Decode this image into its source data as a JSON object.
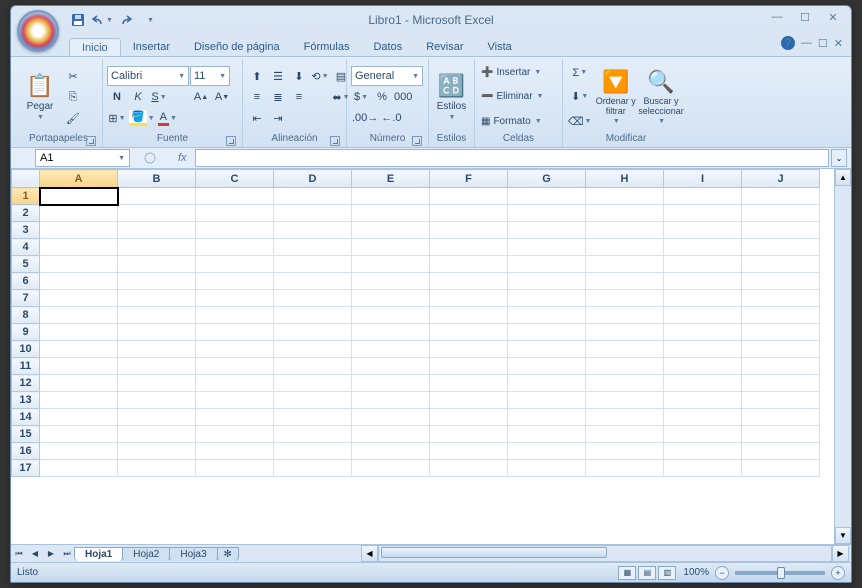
{
  "title": "Libro1 - Microsoft Excel",
  "qat": {
    "save": "💾",
    "undo": "↶",
    "redo": "↷"
  },
  "tabs": {
    "items": [
      "Inicio",
      "Insertar",
      "Diseño de página",
      "Fórmulas",
      "Datos",
      "Revisar",
      "Vista"
    ],
    "active": 0
  },
  "ribbon": {
    "clipboard": {
      "label": "Portapapeles",
      "paste": "Pegar"
    },
    "font": {
      "label": "Fuente",
      "name": "Calibri",
      "size": "11"
    },
    "align": {
      "label": "Alineación"
    },
    "number": {
      "label": "Número",
      "format": "General"
    },
    "styles": {
      "label": "Estilos",
      "btn": "Estilos"
    },
    "cells": {
      "label": "Celdas",
      "insert": "Insertar",
      "delete": "Eliminar",
      "format": "Formato"
    },
    "editing": {
      "label": "Modificar",
      "sort": "Ordenar y filtrar",
      "find": "Buscar y seleccionar"
    }
  },
  "namebox": "A1",
  "columns": [
    "A",
    "B",
    "C",
    "D",
    "E",
    "F",
    "G",
    "H",
    "I",
    "J"
  ],
  "rows": [
    "1",
    "2",
    "3",
    "4",
    "5",
    "6",
    "7",
    "8",
    "9",
    "10",
    "11",
    "12",
    "13",
    "14",
    "15",
    "16",
    "17"
  ],
  "activeCell": {
    "r": 0,
    "c": 0
  },
  "sheets": {
    "items": [
      "Hoja1",
      "Hoja2",
      "Hoja3"
    ],
    "active": 0
  },
  "status": {
    "ready": "Listo",
    "zoom": "100%"
  }
}
